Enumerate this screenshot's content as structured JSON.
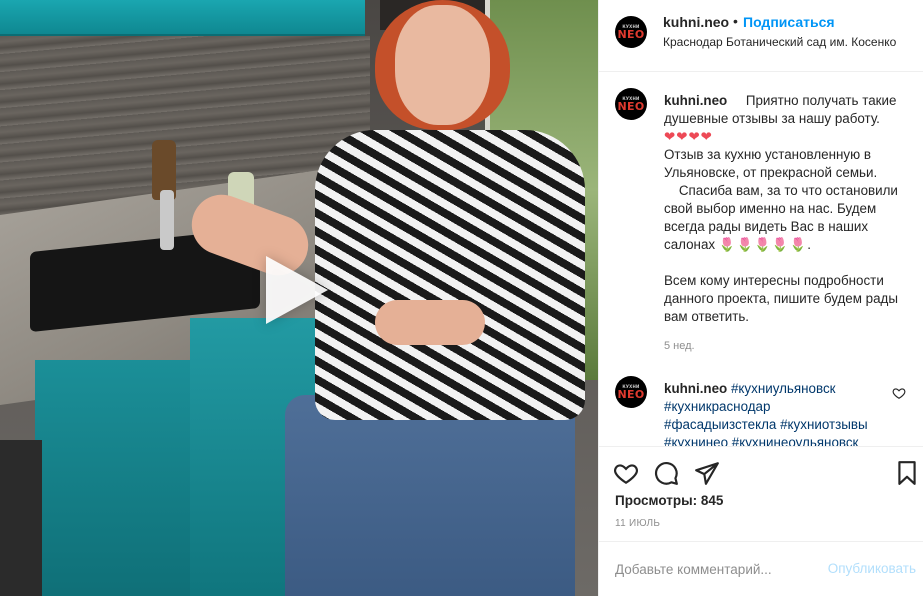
{
  "post": {
    "username": "kuhni.neo",
    "follow_label": "Подписаться",
    "dot": "•",
    "location": "Краснодар Ботанический сад им. Косенко",
    "avatar_small": "КУХНИ",
    "avatar_big": "NEO"
  },
  "caption": {
    "username": "kuhni.neo",
    "line1": "Приятно получать такие душевные отзывы за нашу работу.",
    "hearts": "❤❤❤❤",
    "line2": "Отзыв за кухню установленную в Ульяновске, от прекрасной семьи.",
    "line3": "Спасиба вам, за то что остановили свой выбор именно на нас. Будем всегда рады видеть Вас в наших салонах",
    "tulips": "🌷🌷🌷🌷🌷",
    "line3_end": ".",
    "line4": "Всем кому интересны подробности данного проекта, пишите будем рады вам ответить.",
    "time": "5 нед."
  },
  "comment2": {
    "username": "kuhni.neo",
    "tags": [
      "#кухниульяновск",
      "#кухникраснодар",
      "#фасадыизстекла",
      "#кухниотзывы",
      "#кухнинео",
      "#кухнинеоульяновск"
    ]
  },
  "actions": {
    "views_label": "Просмотры: 845",
    "date": "11 ИЮЛЬ",
    "comment_placeholder": "Добавьте комментарий...",
    "publish_label": "Опубликовать"
  },
  "icons": {
    "like": "heart-icon",
    "comment": "comment-icon",
    "share": "share-icon",
    "save": "bookmark-icon",
    "play": "play-icon"
  },
  "colors": {
    "link_blue": "#0095f6",
    "tag_blue": "#00376b",
    "muted": "#8e8e8e",
    "heart_red": "#ed4956"
  }
}
